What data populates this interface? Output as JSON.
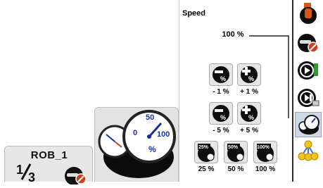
{
  "robot": {
    "name": "ROB_1",
    "task_fraction": "1/3"
  },
  "speed": {
    "title": "Speed",
    "value": "100 %",
    "buttons": [
      {
        "label": "- 1 %",
        "icon": "speed-decrease-1-icon"
      },
      {
        "label": "+ 1 %",
        "icon": "speed-increase-1-icon"
      },
      {
        "label": "- 5 %",
        "icon": "speed-decrease-5-icon"
      },
      {
        "label": "+ 5 %",
        "icon": "speed-increase-5-icon"
      },
      {
        "label": "25 %",
        "icon": "speed-25-icon",
        "badge": "25%"
      },
      {
        "label": "50 %",
        "icon": "speed-50-icon",
        "badge": "50%"
      },
      {
        "label": "100 %",
        "icon": "speed-100-icon",
        "badge": "100%"
      }
    ]
  },
  "gauge": {
    "small_dial": "50",
    "dial_left": "0",
    "dial_right": "100",
    "unit": "%"
  },
  "toolbar": [
    "robot-arm-icon",
    "mechanical-unit-disabled-icon",
    "run-mode-icon",
    "step-mode-icon",
    "speed-gauge-icon",
    "task-tree-icon"
  ],
  "colors": {
    "accent": "#1a2f9a",
    "warning": "#d0401b",
    "panel": "#e6e6e6"
  }
}
